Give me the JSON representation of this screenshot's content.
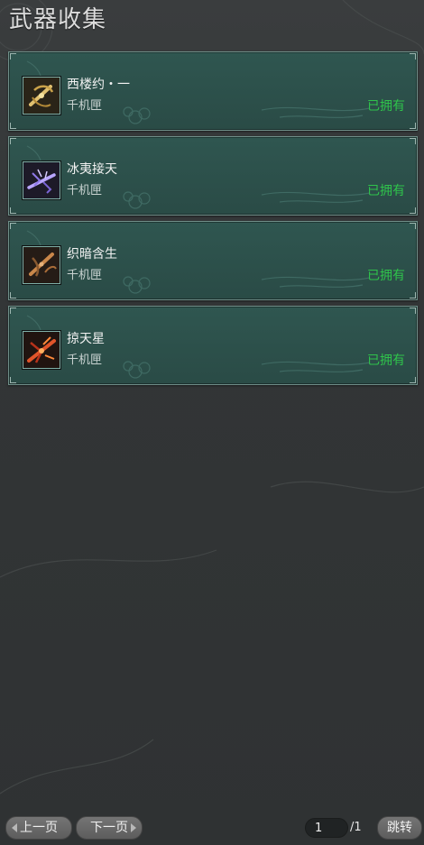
{
  "page": {
    "title": "武器收集"
  },
  "weapons": [
    {
      "name": "西楼约・一",
      "type": "千机匣",
      "status": "已拥有",
      "icon": "crossbow-gold-icon"
    },
    {
      "name": "冰夷接天",
      "type": "千机匣",
      "status": "已拥有",
      "icon": "crossbow-violet-icon"
    },
    {
      "name": "织暗含生",
      "type": "千机匣",
      "status": "已拥有",
      "icon": "crossbow-bronze-icon"
    },
    {
      "name": "掠天星",
      "type": "千机匣",
      "status": "已拥有",
      "icon": "crossbow-flame-icon"
    }
  ],
  "pagination": {
    "prev_label": "上一页",
    "next_label": "下一页",
    "current_page": "1",
    "total_label": "/1",
    "jump_label": "跳转"
  },
  "colors": {
    "owned": "#2fc34b",
    "card": "#2d524c"
  }
}
